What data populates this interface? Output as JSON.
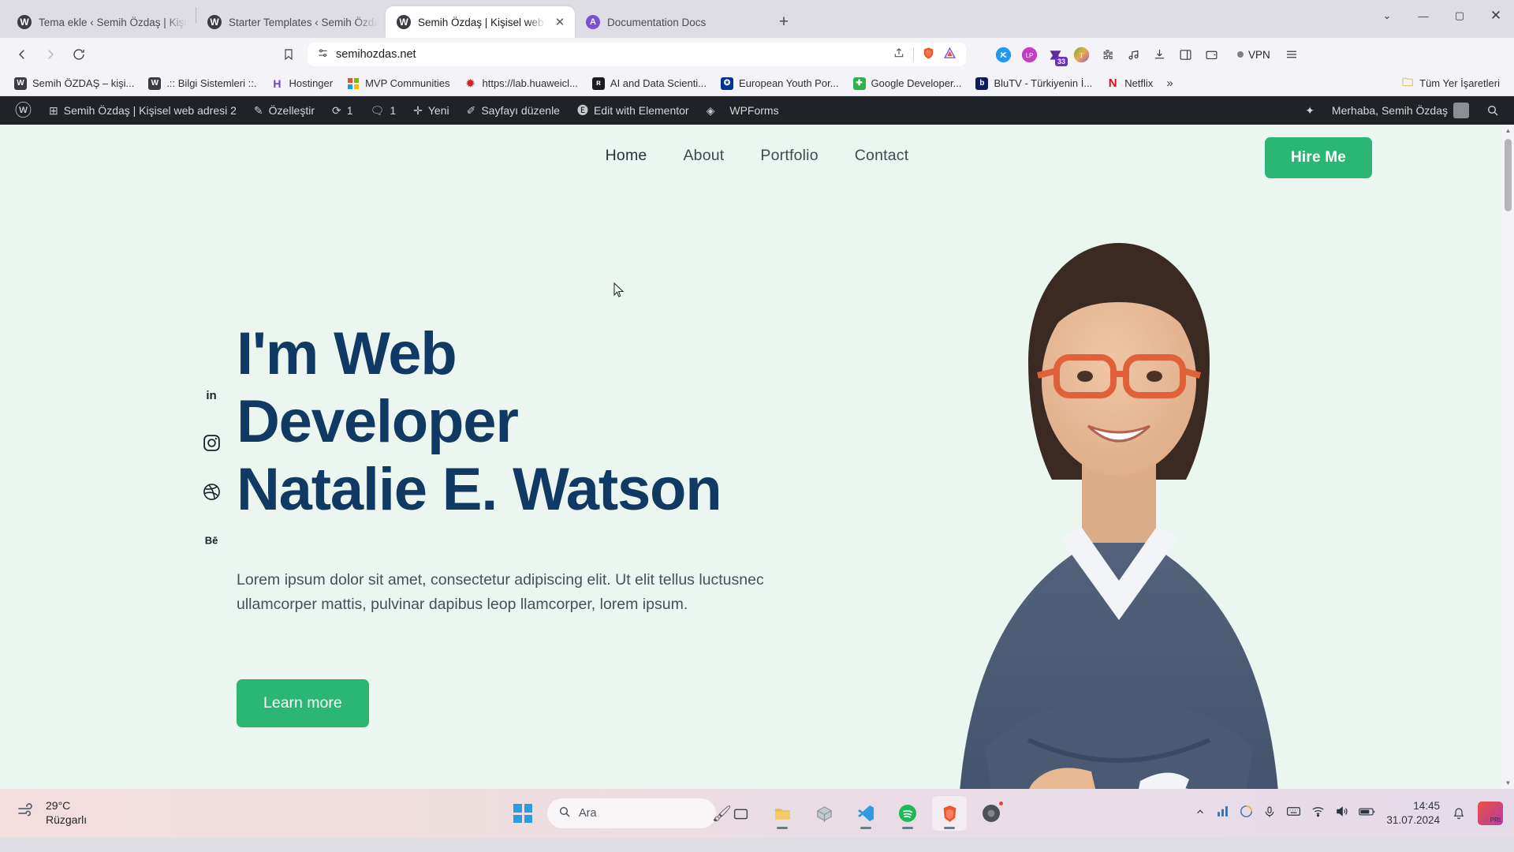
{
  "browser": {
    "tabs": [
      {
        "title": "Tema ekle ‹ Semih Özdaş | Kişisel web",
        "icon": "wordpress-icon",
        "active": false
      },
      {
        "title": "Starter Templates ‹ Semih Özdaş | Kiş",
        "icon": "wordpress-icon",
        "active": false
      },
      {
        "title": "Semih Özdaş | Kişisel web adresi",
        "icon": "wordpress-icon",
        "active": true
      },
      {
        "title": "Documentation Docs",
        "icon": "docs-icon",
        "active": false
      }
    ],
    "new_tab_label": "+",
    "window_controls": {
      "list": "⌄",
      "minimize": "—",
      "maximize": "▢",
      "close": "✕"
    },
    "nav": {
      "back": "back-icon",
      "forward": "forward-icon",
      "reload": "reload-icon"
    },
    "omnibox": {
      "url": "semihozdas.net",
      "bookmark_icon": "bookmark-icon",
      "site_icon": "tune-icon",
      "share_icon": "share-icon",
      "shields_icon": "brave-shields-icon",
      "rewards_icon": "brave-rewards-icon"
    },
    "extensions": [
      {
        "name": "shazam-extension",
        "glyph": "S",
        "color": "#1e9bf0",
        "badge": ""
      },
      {
        "name": "lastpass-extension",
        "glyph": "LP",
        "color": "#c13fc1",
        "badge": ""
      },
      {
        "name": "pocket-extension",
        "glyph": "◆",
        "color": "#5b2d9c",
        "badge": "33"
      },
      {
        "name": "grammarly-extension",
        "glyph": "T",
        "color": "#6ab04c",
        "badge": ""
      },
      {
        "name": "puzzle-extension",
        "glyph": "🧩",
        "color": "#6d6d75",
        "badge": ""
      },
      {
        "name": "music-extension",
        "glyph": "♪",
        "color": "#3c3c42",
        "badge": ""
      },
      {
        "name": "downloads-button",
        "glyph": "⤓",
        "color": "#3c3c42",
        "badge": ""
      },
      {
        "name": "sidebar-button",
        "glyph": "▤",
        "color": "#3c3c42",
        "badge": ""
      },
      {
        "name": "wallet-button",
        "glyph": "▭",
        "color": "#3c3c42",
        "badge": ""
      }
    ],
    "vpn_label": "VPN",
    "menu_icon": "hamburger-menu-icon"
  },
  "bookmarks": {
    "items": [
      {
        "label": "Semih ÖZDAŞ – kişi...",
        "glyph": "W",
        "color": "#3b3b44"
      },
      {
        "label": ".:: Bilgi Sistemleri ::.",
        "glyph": "W",
        "color": "#3b3b44"
      },
      {
        "label": "Hostinger",
        "glyph": "H",
        "color": "#6b3fd4"
      },
      {
        "label": "MVP Communities",
        "glyph": "▦",
        "color": "#ffffff"
      },
      {
        "label": "https://lab.huaweicl...",
        "glyph": "✹",
        "color": "#d4231e"
      },
      {
        "label": "AI and Data Scienti...",
        "glyph": "ʀ",
        "color": "#1c1c1e"
      },
      {
        "label": "European Youth Por...",
        "glyph": "✪",
        "color": "#003399"
      },
      {
        "label": "Google Developer...",
        "glyph": "✚",
        "color": "#2db34a"
      },
      {
        "label": "BluTV - Türkiyenin İ...",
        "glyph": "b",
        "color": "#0b1e5b"
      },
      {
        "label": "Netflix",
        "glyph": "N",
        "color": "#e50914"
      }
    ],
    "overflow_label": "»",
    "folder_label": "Tüm Yer İşaretleri",
    "folder_icon": "folder-icon"
  },
  "wp_admin_bar": {
    "logo_icon": "wordpress-logo-icon",
    "site_name": "Semih Özdaş | Kişisel web adresi 2",
    "site_icon": "dashboard-icon",
    "customize": {
      "label": "Özelleştir",
      "icon": "brush-icon"
    },
    "updates": {
      "count": "1",
      "icon": "updates-icon"
    },
    "comments": {
      "count": "1",
      "icon": "comment-icon"
    },
    "new": {
      "label": "Yeni",
      "icon": "plus-icon"
    },
    "edit_page": {
      "label": "Sayfayı düzenle",
      "icon": "pencil-icon"
    },
    "elementor": {
      "label": "Edit with Elementor",
      "icon": "elementor-icon"
    },
    "wpforms": {
      "label": "WPForms",
      "icon": "wpforms-icon"
    },
    "greeting": "Merhaba, Semih Özdaş",
    "sparkle_icon": "sparkle-icon",
    "search_icon": "search-icon",
    "avatar": "avatar"
  },
  "site": {
    "nav": [
      {
        "label": "Home",
        "active": true
      },
      {
        "label": "About",
        "active": false
      },
      {
        "label": "Portfolio",
        "active": false
      },
      {
        "label": "Contact",
        "active": false
      }
    ],
    "cta_label": "Hire Me",
    "social": [
      {
        "name": "linkedin-icon",
        "glyph": "in"
      },
      {
        "name": "instagram-icon",
        "glyph": "◙"
      },
      {
        "name": "dribbble-icon",
        "glyph": "◉"
      },
      {
        "name": "behance-icon",
        "glyph": "Bē"
      }
    ],
    "heading_lines": [
      "I'm Web",
      "Developer",
      "Natalie E. Watson"
    ],
    "paragraph": "Lorem ipsum dolor sit amet, consectetur adipiscing elit. Ut elit tellus luctusnec ullamcorper mattis, pulvinar dapibus leop llamcorper, lorem ipsum.",
    "learn_more_label": "Learn more",
    "colors": {
      "accent": "#2bb673",
      "heading": "#103a63",
      "background": "#eaf6ef"
    },
    "hero_image": "portrait-woman-glasses-photo"
  },
  "taskbar": {
    "weather": {
      "temperature": "29°C",
      "condition": "Rüzgarlı",
      "icon": "wind-icon"
    },
    "start_icon": "windows-start-icon",
    "search_placeholder": "Ara",
    "search_icon": "search-icon",
    "apps": [
      {
        "name": "task-view-button",
        "glyph": "▭"
      },
      {
        "name": "file-explorer-app",
        "glyph": "📁"
      },
      {
        "name": "package-app",
        "glyph": "📦"
      },
      {
        "name": "vscode-app",
        "glyph": "◁▷"
      },
      {
        "name": "spotify-app",
        "glyph": "♫"
      },
      {
        "name": "brave-browser-app",
        "glyph": "🦁"
      },
      {
        "name": "chrome-app",
        "glyph": "◉"
      }
    ],
    "tray": [
      {
        "name": "show-hidden-icons",
        "glyph": "⌃"
      },
      {
        "name": "stats-icon",
        "glyph": "▥"
      },
      {
        "name": "antivirus-icon",
        "glyph": "◔"
      },
      {
        "name": "microphone-icon",
        "glyph": "🎤"
      },
      {
        "name": "keyboard-icon",
        "glyph": "⌨"
      },
      {
        "name": "wifi-icon",
        "glyph": "◥"
      },
      {
        "name": "volume-icon",
        "glyph": "🔊"
      },
      {
        "name": "battery-icon",
        "glyph": "▭"
      }
    ],
    "clock": {
      "time": "14:45",
      "date": "31.07.2024"
    },
    "notification_icon": "bell-icon"
  }
}
